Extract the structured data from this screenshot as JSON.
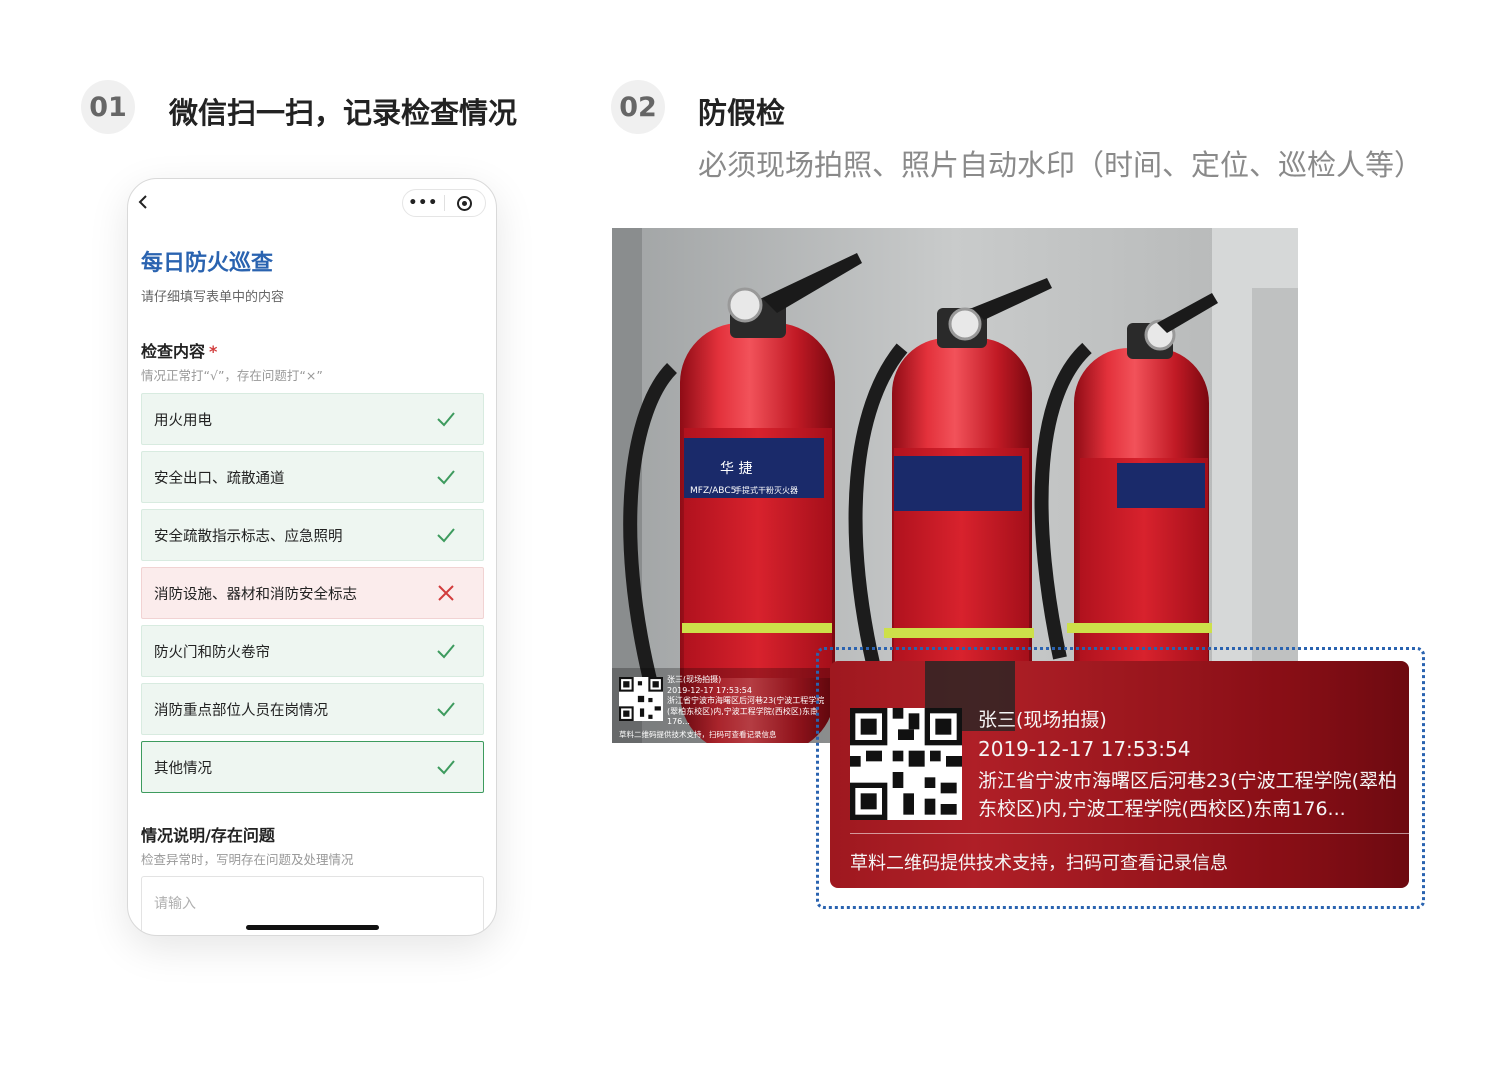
{
  "steps": [
    {
      "num": "01",
      "title": "微信扫一扫，记录检查情况"
    },
    {
      "num": "02",
      "title": "防假检",
      "subtitle": "必须现场拍照、照片自动水印（时间、定位、巡检人等）"
    }
  ],
  "phone": {
    "form_title": "每日防火巡查",
    "form_desc": "请仔细填写表单中的内容",
    "section1": {
      "label": "检查内容",
      "required": "*",
      "hint": "情况正常打“√”，存在问题打“×”"
    },
    "items": [
      {
        "label": "用火用电",
        "status": "ok"
      },
      {
        "label": "安全出口、疏散通道",
        "status": "ok"
      },
      {
        "label": "安全疏散指示标志、应急照明",
        "status": "ok"
      },
      {
        "label": "消防设施、器材和消防安全标志",
        "status": "bad"
      },
      {
        "label": "防火门和防火卷帘",
        "status": "ok"
      },
      {
        "label": "消防重点部位人员在岗情况",
        "status": "ok"
      },
      {
        "label": "其他情况",
        "status": "ok"
      }
    ],
    "section2": {
      "label": "情况说明/存在问题",
      "hint": "检查异常时，写明存在问题及处理情况"
    },
    "input_placeholder": "请输入"
  },
  "photo": {
    "extinguisher_text": {
      "brand": "华 捷",
      "model": "MFZ/ABC5",
      "name": "手提式干粉灭火器"
    },
    "watermark": {
      "name": "张三(现场拍摄)",
      "time": "2019-12-17 17:53:54",
      "address": "浙江省宁波市海曙区后河巷23(宁波工程学院(翠柏东校区)内,宁波工程学院(西校区)东南176...",
      "footer": "草料二维码提供技术支持，扫码可查看记录信息"
    }
  },
  "colors": {
    "accent": "#2a63b0",
    "ok": "#3d9b5e",
    "bad": "#d23c3c"
  },
  "icons": {
    "back": "chevron-left-icon",
    "more": "more-dots-icon",
    "target": "target-icon",
    "ok": "check-icon",
    "bad": "cross-icon"
  }
}
